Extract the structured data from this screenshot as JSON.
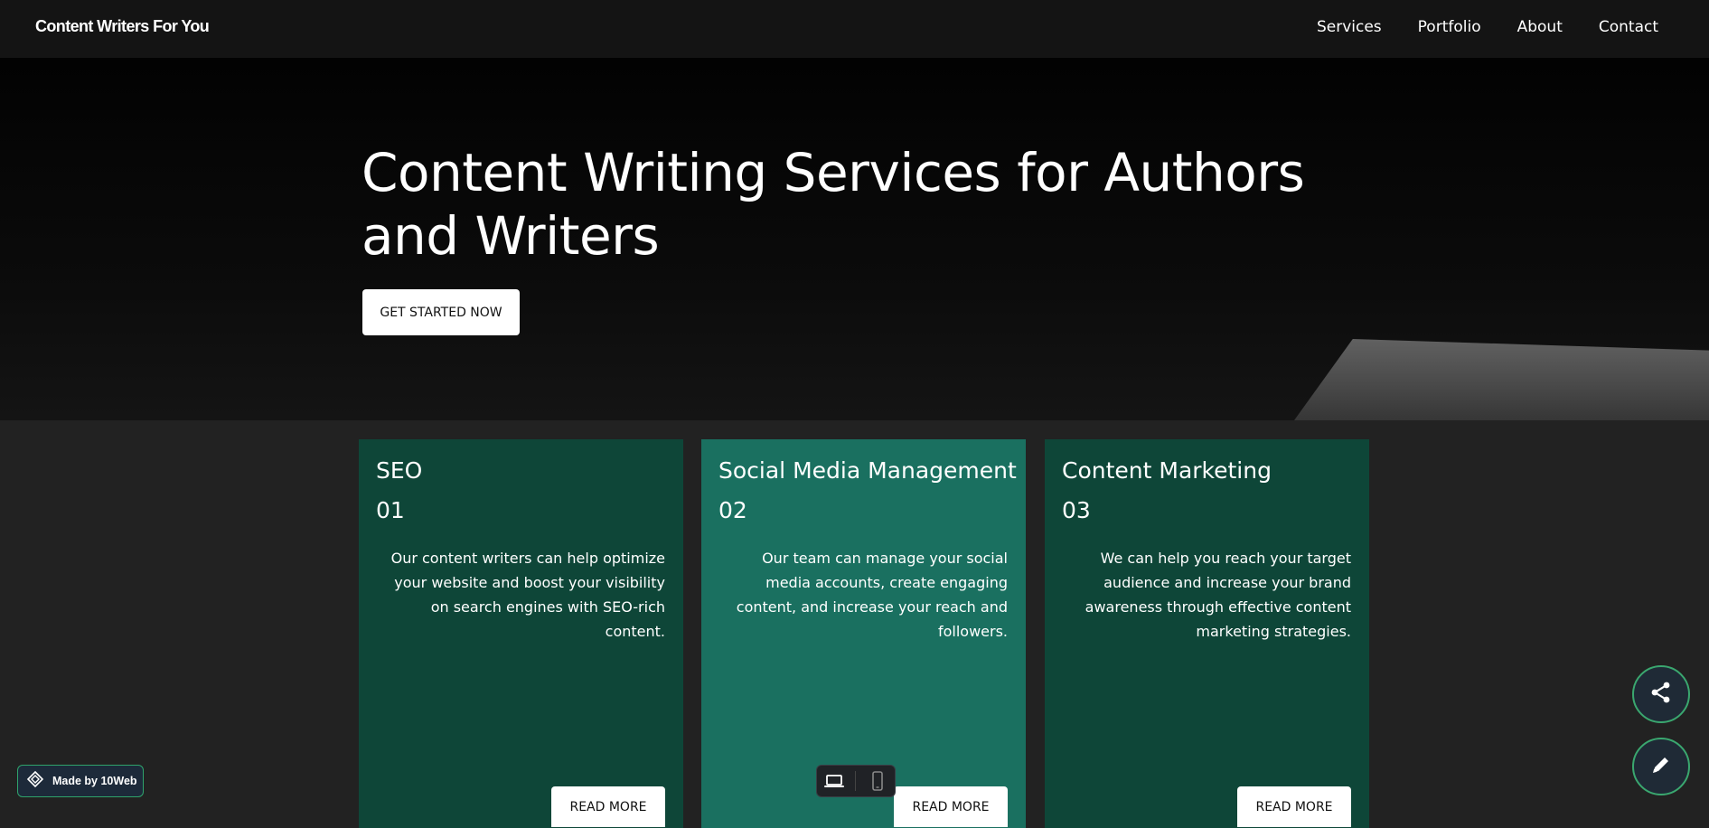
{
  "header": {
    "brand": "Content Writers For You",
    "nav": [
      "Services",
      "Portfolio",
      "About",
      "Contact"
    ]
  },
  "hero": {
    "title": "Content Writing Services for Authors and Writers",
    "cta_label": "GET STARTED NOW"
  },
  "services": [
    {
      "title": "SEO",
      "number": "01",
      "description": "Our content writers can help optimize your website and boost your visibility on search engines with SEO-rich content.",
      "button_label": "READ MORE"
    },
    {
      "title": "Social Media Management",
      "number": "02",
      "description": "Our team can manage your social media accounts, create engaging content, and increase your reach and followers.",
      "button_label": "READ MORE"
    },
    {
      "title": "Content Marketing",
      "number": "03",
      "description": "We can help you reach your target audience and increase your brand awareness through effective content marketing strategies.",
      "button_label": "READ MORE"
    }
  ],
  "badge": {
    "label": "Made by 10Web",
    "icon": "10web-logo-icon"
  },
  "device_switcher": {
    "icons": [
      "laptop-icon",
      "mobile-icon"
    ],
    "active": "laptop"
  },
  "floating_actions": {
    "icons": [
      "share-icon",
      "edit-pencil-icon"
    ]
  },
  "colors": {
    "topbar": "#141414",
    "card_dark": "#0e4638",
    "card_light": "#1a7060",
    "page_bg": "#222222",
    "accent_border": "#3aa76f"
  }
}
